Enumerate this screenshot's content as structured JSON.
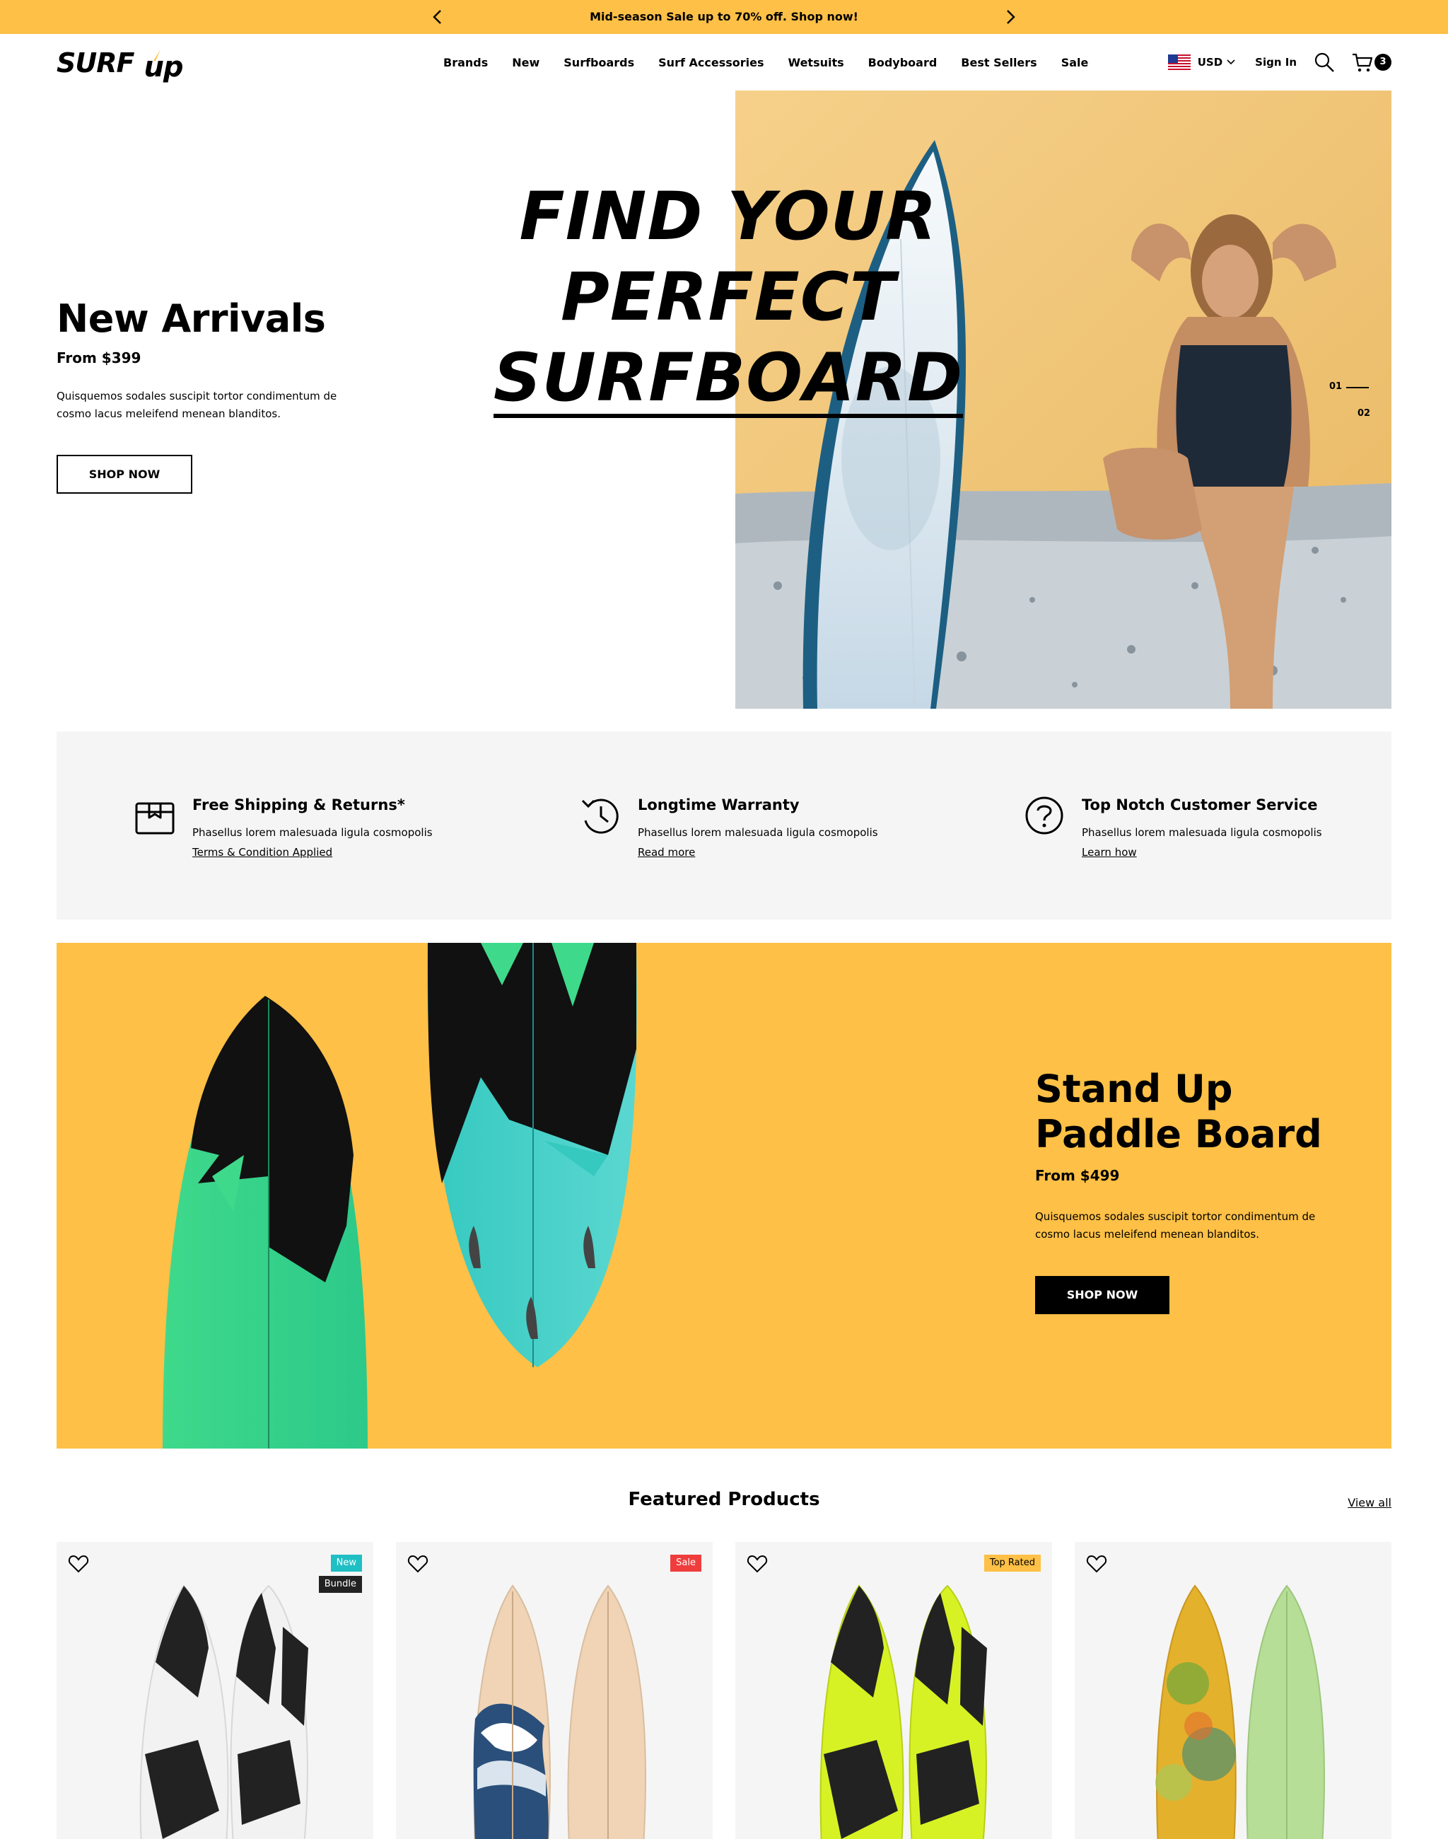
{
  "announcement": {
    "text": "Mid-season Sale up to 70% off. Shop now!",
    "prev_icon": "chevron-left-icon",
    "next_icon": "chevron-right-icon",
    "bg": "#fec046"
  },
  "header": {
    "logo": {
      "main": "SURF",
      "sub": "up"
    },
    "nav": [
      "Brands",
      "New",
      "Surfboards",
      "Surf Accessories",
      "Wetsuits",
      "Bodyboard",
      "Best Sellers",
      "Sale"
    ],
    "currency": "USD",
    "sign_in": "Sign In",
    "cart_count": "3"
  },
  "hero": {
    "title_lines": [
      "FIND YOUR",
      "PERFECT",
      "SURFBOARD"
    ],
    "heading": "New Arrivals",
    "price": "From $399",
    "description": "Quisquemos sodales suscipit tortor condimentum de cosmo lacus meleifend menean blanditos.",
    "button": "SHOP NOW",
    "slides": [
      "01",
      "02"
    ]
  },
  "features": [
    {
      "icon": "box-icon",
      "title": "Free Shipping & Returns*",
      "desc": "Phasellus lorem malesuada ligula cosmopolis",
      "link": "Terms & Condition Applied"
    },
    {
      "icon": "history-icon",
      "title": "Longtime Warranty",
      "desc": "Phasellus lorem malesuada ligula cosmopolis",
      "link": "Read more"
    },
    {
      "icon": "question-icon",
      "title": "Top Notch Customer Service",
      "desc": "Phasellus lorem malesuada ligula cosmopolis",
      "link": "Learn how"
    }
  ],
  "promo": {
    "heading_line1": "Stand Up",
    "heading_line2": "Paddle Board",
    "price": "From $499",
    "description": "Quisquemos sodales suscipit tortor condimentum de cosmo lacus meleifend menean blanditos.",
    "button": "SHOP NOW"
  },
  "featured": {
    "title": "Featured Products",
    "view_all": "View all",
    "products": [
      {
        "badges": [
          {
            "text": "New",
            "color": "#1fbfc4"
          },
          {
            "text": "Bundle",
            "color": "#222222"
          }
        ]
      },
      {
        "badges": [
          {
            "text": "Sale",
            "color": "#ef3d3d"
          }
        ]
      },
      {
        "badges": [
          {
            "text": "Top Rated",
            "color": "#fec046"
          }
        ]
      },
      {
        "badges": []
      }
    ]
  }
}
